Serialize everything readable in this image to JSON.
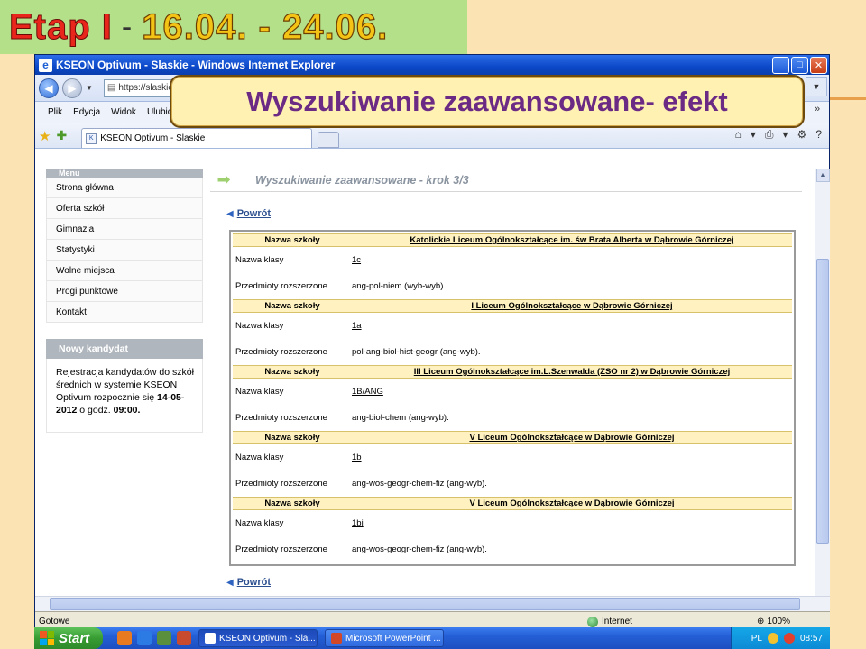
{
  "slide": {
    "etap": "Etap I",
    "dash": "-",
    "dates": "16.04. - 24.06."
  },
  "callout": {
    "text": "Wyszukiwanie zaawansowane- efekt"
  },
  "window": {
    "title": "KSEON Optivum - Slaskie - Windows Internet Explorer",
    "url": "https://slaskie",
    "menu": [
      "Plik",
      "Edycja",
      "Widok",
      "Ulubio"
    ],
    "tab_title": "KSEON Optivum - Slaskie",
    "status_left": "Gotowe",
    "zone": "Internet",
    "zoom": "100%"
  },
  "sidebar": {
    "menu_header": "Menu",
    "items": [
      {
        "label": "Strona główna"
      },
      {
        "label": "Oferta szkół"
      },
      {
        "label": "Gimnazja"
      },
      {
        "label": "Statystyki"
      },
      {
        "label": "Wolne miejsca"
      },
      {
        "label": "Progi punktowe"
      },
      {
        "label": "Kontakt"
      }
    ],
    "nowy_header": "Nowy kandydat",
    "nowy_text_1": "Rejestracja kandydatów do szkół średnich w systemie KSEON Optivum rozpocznie się ",
    "nowy_date": "14-05-2012",
    "nowy_text_2": " o godz. ",
    "nowy_time": "09:00."
  },
  "main": {
    "step_title": "Wyszukiwanie zaawansowane - krok 3/3",
    "back_label": "Powrót",
    "label_school": "Nazwa szkoły",
    "label_class": "Nazwa klasy",
    "label_subjects": "Przedmioty rozszerzone",
    "results": [
      {
        "school": "Katolickie Liceum Ogólnokształcące im. św Brata Alberta w Dąbrowie Górniczej",
        "class": "1c",
        "subjects": "ang-pol-niem (wyb-wyb)."
      },
      {
        "school": "I Liceum Ogólnokształcące w Dąbrowie Górniczej",
        "class": "1a",
        "subjects": "pol-ang-biol-hist-geogr (ang-wyb)."
      },
      {
        "school": "III Liceum Ogólnokształcące im.L.Szenwalda (ZSO nr 2) w Dąbrowie Górniczej",
        "class": "1B/ANG",
        "subjects": "ang-biol-chem (ang-wyb)."
      },
      {
        "school": "V Liceum Ogólnokształcące w Dąbrowie Górniczej",
        "class": "1b",
        "subjects": "ang-wos-geogr-chem-fiz (ang-wyb)."
      },
      {
        "school": "V Liceum Ogólnokształcące w Dąbrowie Górniczej",
        "class": "1bi",
        "subjects": "ang-wos-geogr-chem-fiz (ang-wyb)."
      }
    ]
  },
  "taskbar": {
    "start": "Start",
    "task1": "KSEON Optivum - Sla...",
    "task2": "Microsoft PowerPoint ...",
    "lang": "PL",
    "clock": "08:57"
  }
}
